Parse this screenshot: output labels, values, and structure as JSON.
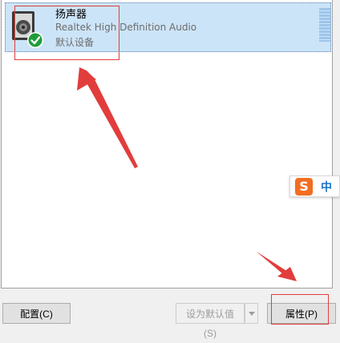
{
  "device": {
    "name": "扬声器",
    "driver": "Realtek High Definition Audio",
    "status": "默认设备",
    "icon": "speaker-icon",
    "status_icon": "default-check-icon"
  },
  "buttons": {
    "configure": "配置(C)",
    "set_default": "设为默认值(S)",
    "properties": "属性(P)"
  },
  "ime": {
    "logo": "S",
    "mode": "中"
  },
  "colors": {
    "selection": "#cce4f7",
    "annotation": "#e23d3d",
    "check": "#1f9d3a"
  }
}
